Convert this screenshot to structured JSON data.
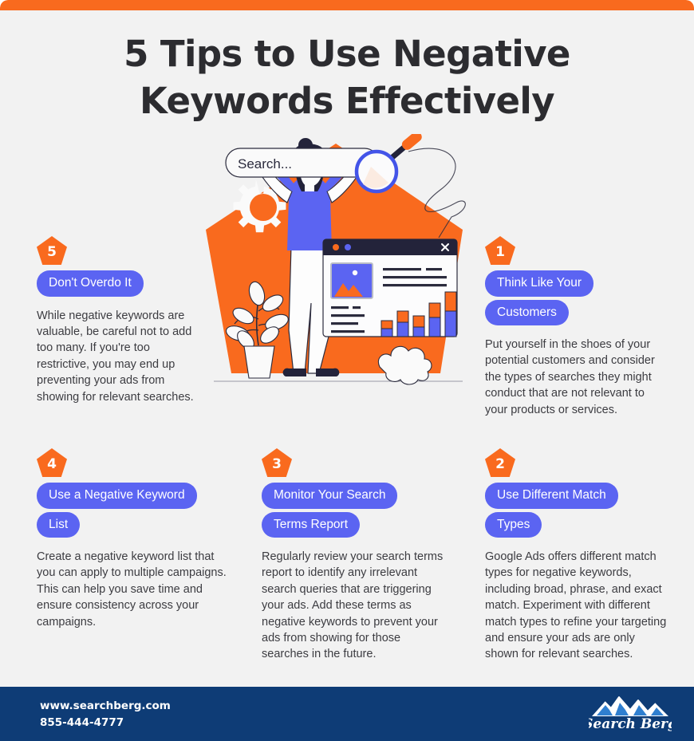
{
  "theme": {
    "accent_orange": "#f96a1e",
    "pill_blue": "#5b64f2",
    "footer_navy": "#0e3c76",
    "background": "#f2f2f2",
    "heading_dark": "#2c2c30"
  },
  "header": {
    "title_line_1": "5 Tips to Use Negative",
    "title_line_2": "Keywords Effectively"
  },
  "hero": {
    "search_placeholder": "Search...",
    "magnifier_icon": "magnifying-glass-icon",
    "gear_icon": "gear-icon",
    "plant_icon": "potted-plant-icon",
    "browser_close_icon": "close-icon",
    "chart_icon": "bar-chart-icon",
    "person_icon": "person-raising-search-bar-icon"
  },
  "tips": [
    {
      "number": "5",
      "title_lines": [
        "Don't Overdo It"
      ],
      "body": "While negative keywords are valuable, be careful not to add too many. If you're too restrictive, you may end up preventing your ads from showing for relevant searches."
    },
    {
      "number": "1",
      "title_lines": [
        "Think Like Your",
        "Customers"
      ],
      "body": "Put yourself in the shoes of your potential customers and consider the types of searches they might conduct that are not relevant to your products or services."
    },
    {
      "number": "4",
      "title_lines": [
        "Use a Negative Keyword",
        "List"
      ],
      "body": "Create a negative keyword list that you can apply to multiple campaigns. This can help you save time and ensure consistency across your campaigns."
    },
    {
      "number": "3",
      "title_lines": [
        "Monitor Your Search",
        "Terms Report"
      ],
      "body": "Regularly review your search terms report to identify any irrelevant search queries that are triggering your ads. Add these terms as negative keywords to prevent your ads from showing for those searches in the future."
    },
    {
      "number": "2",
      "title_lines": [
        "Use Different Match",
        "Types"
      ],
      "body": "Google Ads offers different match types for negative keywords, including broad, phrase, and exact match. Experiment with different match types to refine your targeting and ensure your ads are only shown for relevant searches."
    }
  ],
  "footer": {
    "website": "www.searchberg.com",
    "phone": "855-444-4777",
    "logo_text": "Search Berg",
    "logo_icon": "mountain-logo-icon"
  }
}
